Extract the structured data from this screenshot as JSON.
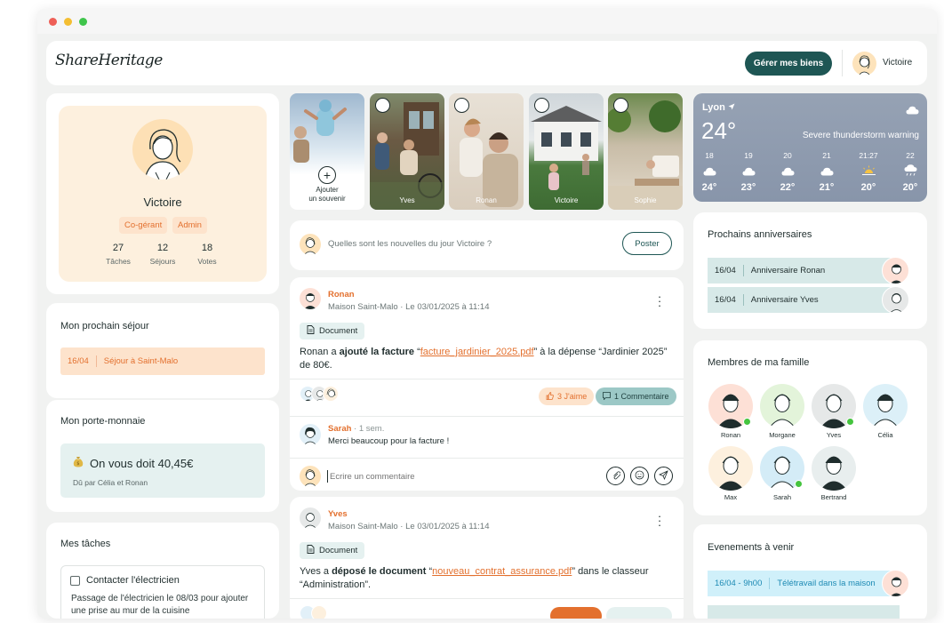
{
  "app": {
    "logo": "ShareHeritage",
    "manage_button": "Gérer mes biens",
    "user_name": "Victoire",
    "window_colors": [
      "#ee5f57",
      "#f4be32",
      "#3fc54b"
    ]
  },
  "profile": {
    "name": "Victoire",
    "badges": [
      "Co-gérant",
      "Admin"
    ],
    "stats": [
      {
        "value": "27",
        "label": "Tâches"
      },
      {
        "value": "12",
        "label": "Séjours"
      },
      {
        "value": "18",
        "label": "Votes"
      }
    ]
  },
  "next_stay": {
    "title": "Mon prochain séjour",
    "date": "16/04",
    "label": "Séjour à Saint-Malo"
  },
  "wallet": {
    "title": "Mon porte-monnaie",
    "icon": "money-bag-icon",
    "amount_text": "On vous doit 40,45€",
    "sub": "Dû par Célia et Ronan"
  },
  "tasks": {
    "title": "Mes tâches",
    "items": [
      {
        "title": "Contacter l'électricien",
        "desc": "Passage de l'électricien le 08/03 pour ajouter une prise au mur de la cuisine"
      }
    ]
  },
  "stories": {
    "add_label_1": "Ajouter",
    "add_label_2": "un souvenir",
    "items": [
      {
        "name": "Yves"
      },
      {
        "name": "Ronan"
      },
      {
        "name": "Victoire"
      },
      {
        "name": "Sophie"
      }
    ]
  },
  "composer": {
    "placeholder": "Quelles sont les nouvelles du jour Victoire ?",
    "post_button": "Poster"
  },
  "posts": [
    {
      "author": "Ronan",
      "meta": "Maison Saint-Malo · Le 03/01/2025 à 11:14",
      "tag": "Document",
      "text_pre": "Ronan a ",
      "text_action": "ajouté la facture",
      "text_mid1": " “",
      "text_link": "facture_jardinier_2025.pdf",
      "text_post": "” à la dépense “Jardinier 2025” de 80€.",
      "likes": "3 J'aime",
      "comments": "1 Commentaire",
      "comment": {
        "author": "Sarah",
        "time": " · 1 sem.",
        "text": "Merci beaucoup pour la facture !"
      },
      "reply_placeholder": "Ecrire un commentaire"
    },
    {
      "author": "Yves",
      "meta": "Maison Saint-Malo · Le 03/01/2025 à 11:14",
      "tag": "Document",
      "text_pre": "Yves a ",
      "text_action": "déposé le document",
      "text_mid1": " “",
      "text_link": "nouveau_contrat_assurance.pdf",
      "text_post": "” dans le classeur “Administration”."
    }
  ],
  "weather": {
    "city": "Lyon",
    "temp": "24°",
    "warning": "Severe thunderstorm warning",
    "hours": [
      {
        "hour": "18",
        "deg": "24°",
        "icon": "cloud-icon"
      },
      {
        "hour": "19",
        "deg": "23°",
        "icon": "cloud-icon"
      },
      {
        "hour": "20",
        "deg": "22°",
        "icon": "cloud-icon"
      },
      {
        "hour": "21",
        "deg": "21°",
        "icon": "cloud-icon"
      },
      {
        "hour": "21:27",
        "deg": "20°",
        "icon": "sunset-icon"
      },
      {
        "hour": "22",
        "deg": "20°",
        "icon": "rain-icon"
      }
    ]
  },
  "birthdays": {
    "title": "Prochains anniversaires",
    "items": [
      {
        "date": "16/04",
        "label": "Anniversaire Ronan"
      },
      {
        "date": "16/04",
        "label": "Anniversaire Yves"
      }
    ]
  },
  "family": {
    "title": "Membres de ma famille",
    "members": [
      {
        "name": "Ronan",
        "color": "#fde0d6",
        "online": true
      },
      {
        "name": "Morgane",
        "color": "#e3f4da",
        "online": false
      },
      {
        "name": "Yves",
        "color": "#e6e8e8",
        "online": true
      },
      {
        "name": "Célia",
        "color": "#dcf0f8",
        "online": false
      },
      {
        "name": "Max",
        "color": "#fdf0de",
        "online": false
      },
      {
        "name": "Sarah",
        "color": "#d4ecf7",
        "online": true
      },
      {
        "name": "Bertrand",
        "color": "#e8eeee",
        "online": false
      }
    ]
  },
  "events": {
    "title": "Evenements à venir",
    "items": [
      {
        "date": "16/04 - 9h00",
        "label": "Télétravail dans la maison"
      }
    ]
  }
}
